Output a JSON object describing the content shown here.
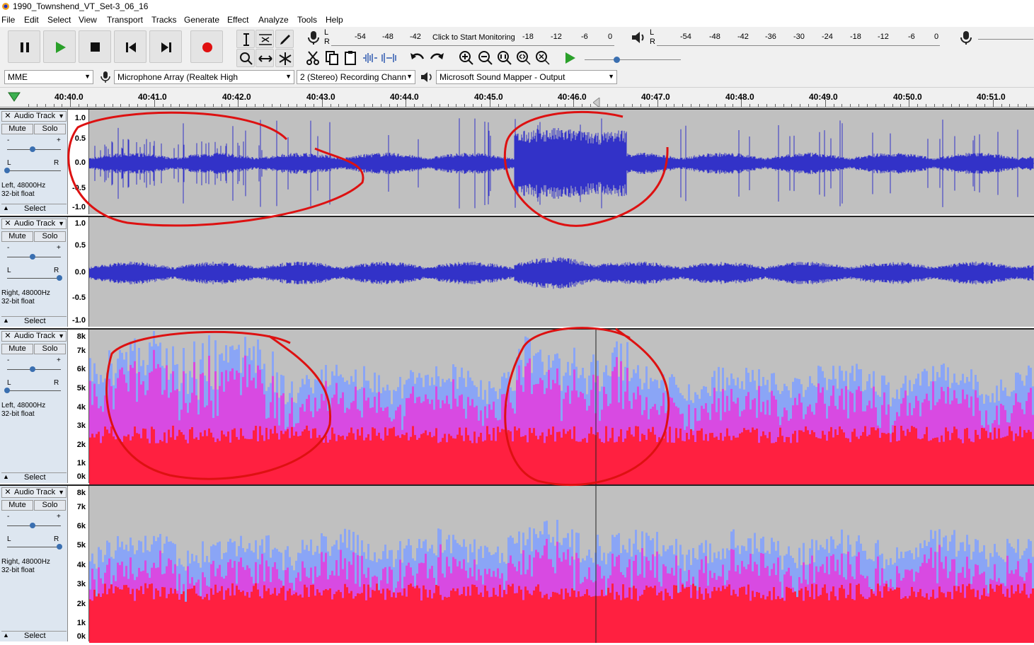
{
  "window": {
    "title": "1990_Townshend_VT_Set-3_06_16"
  },
  "menu": [
    "File",
    "Edit",
    "Select",
    "View",
    "Transport",
    "Tracks",
    "Generate",
    "Effect",
    "Analyze",
    "Tools",
    "Help"
  ],
  "record_meter": {
    "scale": [
      "-54",
      "-48",
      "-42",
      "-18",
      "-12",
      "-6",
      "0"
    ],
    "monitor_text": "Click to Start Monitoring"
  },
  "play_meter": {
    "scale": [
      "-54",
      "-48",
      "-42",
      "-36",
      "-30",
      "-24",
      "-18",
      "-12",
      "-6",
      "0"
    ]
  },
  "record_meter_lr": [
    "L",
    "R"
  ],
  "play_meter_lr": [
    "L",
    "R"
  ],
  "devices": {
    "host": "MME",
    "input": "Microphone Array (Realtek High",
    "channels": "2 (Stereo) Recording Chann",
    "output": "Microsoft Sound Mapper - Output"
  },
  "timeline": {
    "labels": [
      "40:40.0",
      "40:41.0",
      "40:42.0",
      "40:43.0",
      "40:44.0",
      "40:45.0",
      "40:46.0",
      "40:47.0",
      "40:48.0",
      "40:49.0",
      "40:50.0",
      "40:51.0"
    ]
  },
  "tracks": [
    {
      "name": "Audio Track",
      "mute": "Mute",
      "solo": "Solo",
      "gain_lbl": [
        "-",
        "+"
      ],
      "pan_lbl": [
        "L",
        "R"
      ],
      "info1": "Left, 48000Hz",
      "info2": "32-bit float",
      "select": "Select",
      "ruler": [
        "1.0",
        "0.5",
        "0.0",
        "-0.5",
        "-1.0"
      ]
    },
    {
      "name": "Audio Track",
      "mute": "Mute",
      "solo": "Solo",
      "gain_lbl": [
        "-",
        "+"
      ],
      "pan_lbl": [
        "L",
        "R"
      ],
      "info1": "Right, 48000Hz",
      "info2": "32-bit float",
      "select": "Select",
      "ruler": [
        "1.0",
        "0.5",
        "0.0",
        "-0.5",
        "-1.0"
      ]
    },
    {
      "name": "Audio Track",
      "mute": "Mute",
      "solo": "Solo",
      "gain_lbl": [
        "-",
        "+"
      ],
      "pan_lbl": [
        "L",
        "R"
      ],
      "info1": "Left, 48000Hz",
      "info2": "32-bit float",
      "select": "Select",
      "ruler": [
        "8k",
        "7k",
        "6k",
        "5k",
        "4k",
        "3k",
        "2k",
        "1k",
        "0k"
      ]
    },
    {
      "name": "Audio Track",
      "mute": "Mute",
      "solo": "Solo",
      "gain_lbl": [
        "-",
        "+"
      ],
      "pan_lbl": [
        "L",
        "R"
      ],
      "info1": "Right, 48000Hz",
      "info2": "32-bit float",
      "select": "Select",
      "ruler": [
        "8k",
        "7k",
        "6k",
        "5k",
        "4k",
        "3k",
        "2k",
        "1k",
        "0k"
      ]
    }
  ],
  "colors": {
    "waveform": "#3232c8",
    "annotation": "#dd1111",
    "spectrum_hot": "#ff2040",
    "spectrum_mid": "#e040e0",
    "spectrum_cool": "#80a0ff"
  }
}
